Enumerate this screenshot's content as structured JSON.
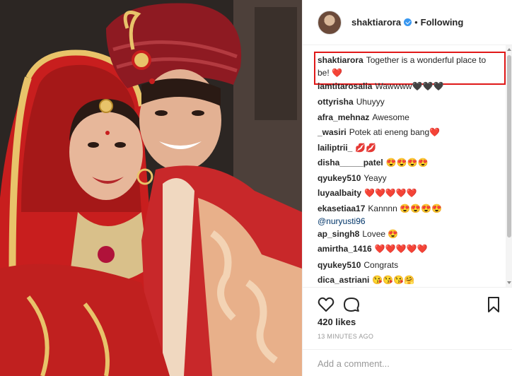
{
  "post": {
    "image_alt": "Couple in traditional Indian wedding attire",
    "colors": {
      "accent_red": "#c81e1e",
      "highlight_box": "#e01818",
      "link": "#003569",
      "verified": "#3897f0"
    }
  },
  "header": {
    "username": "shaktiarora",
    "separator": "•",
    "follow_status": "Following",
    "avatar_icon": "avatar-icon",
    "verified_icon": "verified-badge-icon"
  },
  "caption": {
    "user": "shaktiarora",
    "text": "Together is a wonderful place to be! ❤️"
  },
  "comments": [
    {
      "user": "iamtitarosalia",
      "text": "Wawwww🖤🖤🖤"
    },
    {
      "user": "ottyrisha",
      "text": "Uhuyyy"
    },
    {
      "user": "afra_mehnaz",
      "text": "Awesome"
    },
    {
      "user": "_wasiri",
      "text": "Potek ati eneng bang❤️"
    },
    {
      "user": "lailiptrii_",
      "text": "💋💋"
    },
    {
      "user": "disha_____patel",
      "text": "😍😍😍😍"
    },
    {
      "user": "qyukey510",
      "text": "Yeayy"
    },
    {
      "user": "luyaalbaity",
      "text": "❤️❤️❤️❤️❤️"
    },
    {
      "user": "ekasetiaa17",
      "text": "Kannnn 😍😍😍😍",
      "mention": "@nuryusti96"
    },
    {
      "user": "ap_singh8",
      "text": "Lovee 😍"
    },
    {
      "user": "amirtha_1416",
      "text": "❤️❤️❤️❤️❤️"
    },
    {
      "user": "qyukey510",
      "text": "Congrats"
    },
    {
      "user": "dica_astriani",
      "text": "😘😘😘🤗"
    }
  ],
  "actions": {
    "like_icon": "heart-icon",
    "comment_icon": "comment-icon",
    "save_icon": "bookmark-icon",
    "likes": "420 likes",
    "timestamp": "13 MINUTES AGO"
  },
  "add_comment": {
    "placeholder": "Add a comment..."
  }
}
